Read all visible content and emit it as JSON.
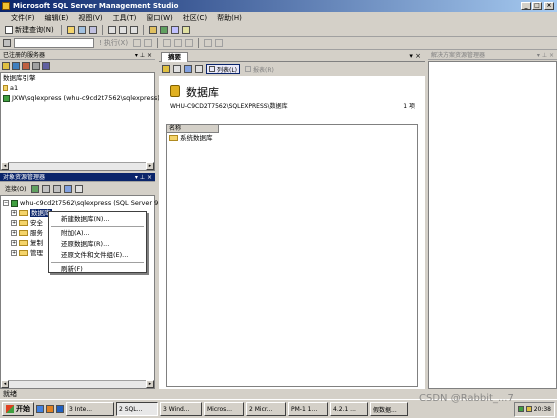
{
  "window": {
    "title": "Microsoft SQL Server Management Studio",
    "controls": [
      "_",
      "□",
      "×"
    ]
  },
  "menu": [
    "文件(F)",
    "编辑(E)",
    "视图(V)",
    "工具(T)",
    "窗口(W)",
    "社区(C)",
    "帮助(H)"
  ],
  "toolbar1": {
    "new_query": "新建查询(N)"
  },
  "toolbar2": {
    "execute": "执行(X)"
  },
  "registered_servers": {
    "header": "已注册的服务器",
    "toolbar_label": "数据库引擎",
    "group": "a1",
    "server": "JXW\\sqlexpress (whu-c9cd2t7562\\sqlexpress)"
  },
  "object_explorer": {
    "header": "对象资源管理器",
    "connect_label": "连接(O)",
    "root": "whu-c9cd2t7562\\sqlexpress (SQL Server 9",
    "nodes": [
      "数据库",
      "安全性",
      "服务器对象",
      "复制",
      "管理"
    ],
    "nodes_visible": [
      "数据库",
      "安全",
      "服务",
      "复制",
      "管理"
    ]
  },
  "context_menu": {
    "items": [
      "新建数据库(N)...",
      "附加(A)...",
      "还原数据库(R)...",
      "还原文件和文件组(E)...",
      "刷新(F)"
    ]
  },
  "summary": {
    "tab_label": "摘要",
    "list_button": "列表(L)",
    "report_button": "报表(R)",
    "heading": "数据库",
    "path": "WHU-C9CD2T7562\\SQLEXPRESS\\数据库",
    "count": "1 项",
    "column_header": "名称",
    "rows": [
      "系统数据库"
    ]
  },
  "properties": {
    "header": "解决方案资源管理器"
  },
  "statusbar": {
    "text": "就绪"
  },
  "taskbar": {
    "start": "开始",
    "tasks": [
      "3 Inte...",
      "2 SQL...",
      "3 Wind...",
      "Micros...",
      "2 Micr...",
      "PM-1 1...",
      "4.2.1 ...",
      "假数据..."
    ],
    "clock": "20:38"
  },
  "watermark": "CSDN @Rabbit_...7"
}
